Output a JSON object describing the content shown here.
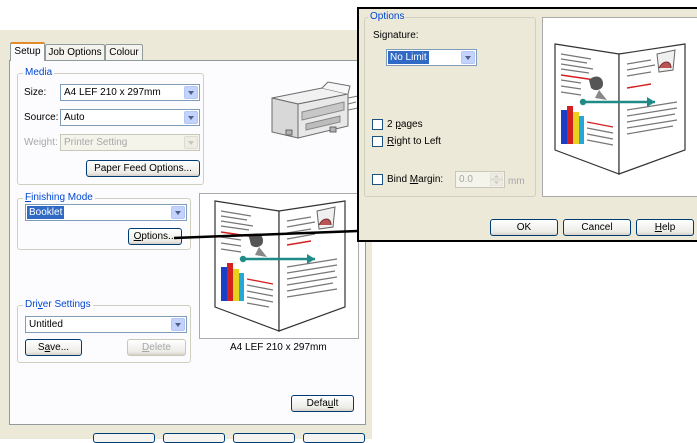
{
  "setup_dialog": {
    "tabs": [
      {
        "label": "Setup",
        "active": true
      },
      {
        "label": "Job Options",
        "active": false
      },
      {
        "label": "Colour",
        "active": false
      }
    ],
    "media": {
      "group_label": "Media",
      "size_label": "Size:",
      "size_value": "A4 LEF 210 x 297mm",
      "source_label": "Source:",
      "source_value": "Auto",
      "weight_label": "Weight:",
      "weight_value": "Printer Setting",
      "paper_feed_button": "Paper Feed Options..."
    },
    "finishing": {
      "group_label": "Finishing Mode",
      "mode_value": "Booklet",
      "options_button": "Options..."
    },
    "preview_caption": "A4 LEF 210 x 297mm",
    "driver_settings": {
      "group_label": "Driver Settings",
      "value": "Untitled",
      "save_button": "Save...",
      "delete_button": "Delete"
    },
    "default_button": "Default"
  },
  "options_dialog": {
    "group_label": "Options",
    "signature_label": "Signature:",
    "signature_value": "No Limit",
    "two_pages_label": "2 pages",
    "two_pages_checked": false,
    "right_to_left_label": "Right to Left",
    "right_to_left_checked": false,
    "bind_margin_label": "Bind Margin:",
    "bind_margin_checked": false,
    "bind_margin_value": "0.0",
    "bind_margin_unit": "mm",
    "ok_button": "OK",
    "cancel_button": "Cancel",
    "help_button": "Help"
  },
  "icons": [
    "printer-icon",
    "booklet-preview-icon",
    "dropdown-arrow-icon",
    "spin-arrows-icon"
  ],
  "colors": {
    "dialog_bg": "#ece9d8",
    "panel_bg": "#fcfcfe",
    "group_label": "#0046d5",
    "selection": "#316ac5",
    "callout_line": "#000000"
  }
}
